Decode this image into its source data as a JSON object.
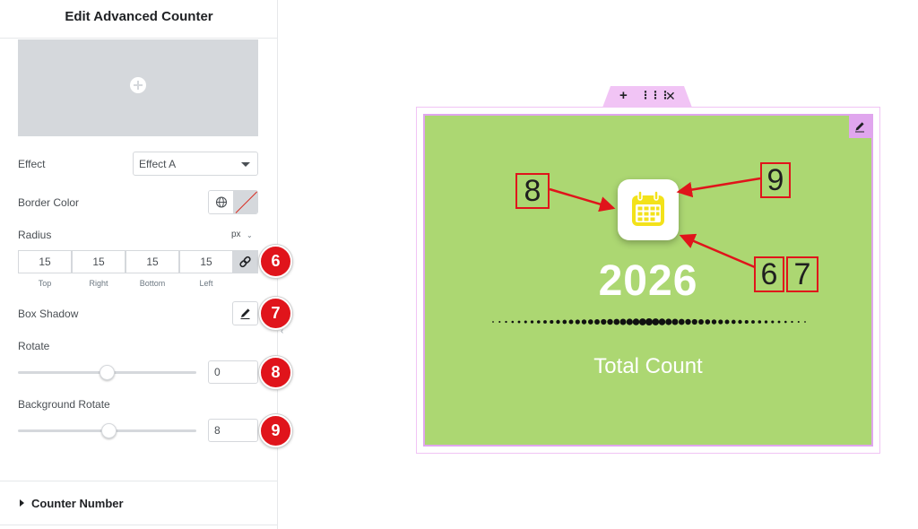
{
  "panel": {
    "title": "Edit Advanced Counter",
    "effect": {
      "label": "Effect",
      "value": "Effect A"
    },
    "border_color": {
      "label": "Border Color"
    },
    "radius": {
      "label": "Radius",
      "unit": "px",
      "fields": [
        {
          "value": "15",
          "label": "Top"
        },
        {
          "value": "15",
          "label": "Right"
        },
        {
          "value": "15",
          "label": "Bottom"
        },
        {
          "value": "15",
          "label": "Left"
        }
      ]
    },
    "box_shadow": {
      "label": "Box Shadow"
    },
    "rotate": {
      "label": "Rotate",
      "value": "0",
      "level": 0.5
    },
    "background_rotate": {
      "label": "Background Rotate",
      "value": "8",
      "level": 0.51
    },
    "section": {
      "label": "Counter Number"
    }
  },
  "badges": [
    "6",
    "7",
    "8",
    "9"
  ],
  "canvas": {
    "counter_number": "2026",
    "counter_title": "Total Count",
    "card_color": "#acd772",
    "icon_color": "#f3e21a"
  },
  "annotations": [
    "8",
    "9",
    "6",
    "7"
  ],
  "colors": {
    "accent_red": "#e0141b",
    "editor_pink": "#e0a6ee"
  }
}
